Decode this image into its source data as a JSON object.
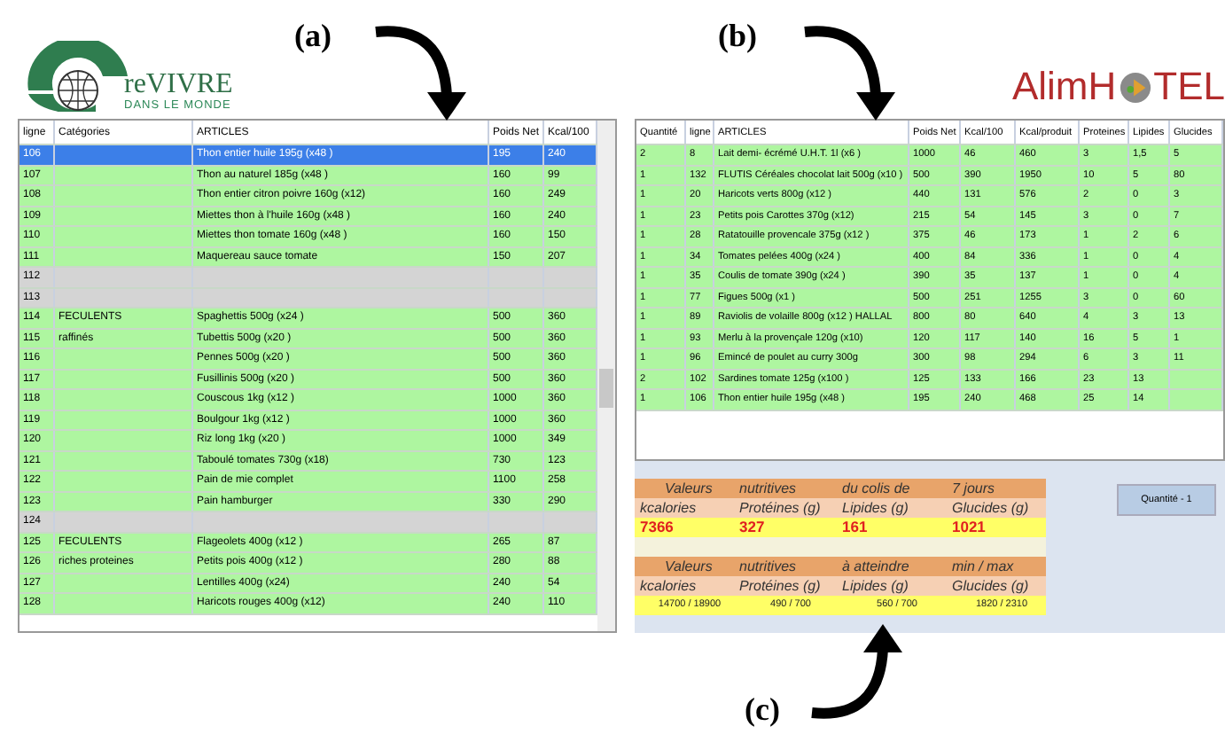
{
  "figure_labels": [
    {
      "text": "(a)"
    },
    {
      "text": "(b)"
    },
    {
      "text": "(c)"
    }
  ],
  "logo_left": {
    "name": "reVIVRE",
    "tagline": "DANS LE MONDE"
  },
  "logo_right": {
    "before": "AlimH",
    "after": "TEL"
  },
  "articles_table": {
    "columns": [
      "ligne",
      "Catégories",
      "ARTICLES",
      "Poids Net",
      "Kcal/100"
    ],
    "rows": [
      {
        "kind": "item",
        "selected": true,
        "line": "106",
        "article": "Thon entier huile 195g (x48 )",
        "weight": "195",
        "kcal": "240"
      },
      {
        "kind": "item",
        "selected": false,
        "line": "107",
        "article": "Thon au naturel 185g (x48 )",
        "weight": "160",
        "kcal": "99"
      },
      {
        "kind": "item",
        "selected": false,
        "line": "108",
        "article": "Thon entier citron poivre 160g (x12)",
        "weight": "160",
        "kcal": "249"
      },
      {
        "kind": "item",
        "selected": false,
        "line": "109",
        "article": "Miettes thon à l'huile 160g (x48 )",
        "weight": "160",
        "kcal": "240"
      },
      {
        "kind": "item",
        "selected": false,
        "line": "110",
        "article": "Miettes thon tomate 160g (x48 )",
        "weight": "160",
        "kcal": "150"
      },
      {
        "kind": "item",
        "selected": false,
        "line": "111",
        "article": "Maquereau sauce tomate",
        "weight": "150",
        "kcal": "207"
      },
      {
        "kind": "blank",
        "selected": false,
        "line": "112"
      },
      {
        "kind": "blank",
        "selected": false,
        "line": "113"
      },
      {
        "kind": "item",
        "selected": false,
        "line": "114",
        "category": "FECULENTS",
        "article": "Spaghettis 500g (x24 )",
        "weight": "500",
        "kcal": "360"
      },
      {
        "kind": "item",
        "selected": false,
        "line": "115",
        "category": "raffinés",
        "article": "Tubettis 500g (x20 )",
        "weight": "500",
        "kcal": "360"
      },
      {
        "kind": "item",
        "selected": false,
        "line": "116",
        "article": "Pennes 500g (x20 )",
        "weight": "500",
        "kcal": "360"
      },
      {
        "kind": "item",
        "selected": false,
        "line": "117",
        "article": "Fusillinis 500g (x20 )",
        "weight": "500",
        "kcal": "360"
      },
      {
        "kind": "item",
        "selected": false,
        "line": "118",
        "article": "Couscous 1kg (x12 )",
        "weight": "1000",
        "kcal": "360"
      },
      {
        "kind": "item",
        "selected": false,
        "line": "119",
        "article": "Boulgour 1kg (x12 )",
        "weight": "1000",
        "kcal": "360"
      },
      {
        "kind": "item",
        "selected": false,
        "line": "120",
        "article": "Riz long 1kg (x20 )",
        "weight": "1000",
        "kcal": "349"
      },
      {
        "kind": "item",
        "selected": false,
        "line": "121",
        "article": "Taboulé tomates 730g (x18)",
        "weight": "730",
        "kcal": "123"
      },
      {
        "kind": "item",
        "selected": false,
        "line": "122",
        "article": "Pain de mie complet",
        "weight": "1100",
        "kcal": "258"
      },
      {
        "kind": "item",
        "selected": false,
        "line": "123",
        "article": "Pain hamburger",
        "weight": "330",
        "kcal": "290"
      },
      {
        "kind": "blank",
        "selected": false,
        "line": "124"
      },
      {
        "kind": "item",
        "selected": false,
        "line": "125",
        "category": "FECULENTS",
        "article": "Flageolets 400g (x12 )",
        "weight": "265",
        "kcal": "87"
      },
      {
        "kind": "item",
        "selected": false,
        "line": "126",
        "category": "riches proteines",
        "article": "Petits pois 400g (x12 )",
        "weight": "280",
        "kcal": "88"
      },
      {
        "kind": "item",
        "selected": false,
        "line": "127",
        "article": "Lentilles 400g (x24)",
        "weight": "240",
        "kcal": "54"
      },
      {
        "kind": "item",
        "selected": false,
        "line": "128",
        "article": "Haricots rouges 400g (x12)",
        "weight": "240",
        "kcal": "110"
      }
    ]
  },
  "basket_table": {
    "columns": [
      "Quantité",
      "ligne",
      "ARTICLES",
      "Poids Net",
      "Kcal/100",
      "Kcal/produit",
      "Proteines",
      "Lipides",
      "Glucides"
    ],
    "rows": [
      [
        "2",
        "8",
        "Lait demi- écrémé U.H.T. 1l (x6 )",
        "1000",
        "46",
        "460",
        "3",
        "1,5",
        "5"
      ],
      [
        "1",
        "132",
        "FLUTIS Céréales chocolat lait 500g (x10 )",
        "500",
        "390",
        "1950",
        "10",
        "5",
        "80"
      ],
      [
        "1",
        "20",
        "Haricots verts 800g (x12 )",
        "440",
        "131",
        "576",
        "2",
        "0",
        "3"
      ],
      [
        "1",
        "23",
        "Petits pois  Carottes 370g (x12)",
        "215",
        "54",
        "145",
        "3",
        "0",
        "7"
      ],
      [
        "1",
        "28",
        "Ratatouille provencale 375g (x12 )",
        "375",
        "46",
        "173",
        "1",
        "2",
        "6"
      ],
      [
        "1",
        "34",
        "Tomates pelées 400g (x24 )",
        "400",
        "84",
        "336",
        "1",
        "0",
        "4"
      ],
      [
        "1",
        "35",
        "Coulis de tomate 390g (x24 )",
        "390",
        "35",
        "137",
        "1",
        "0",
        "4"
      ],
      [
        "1",
        "77",
        "Figues 500g (x1 )",
        "500",
        "251",
        "1255",
        "3",
        "0",
        "60"
      ],
      [
        "1",
        "89",
        "Raviolis de volaille 800g (x12 ) HALLAL",
        "800",
        "80",
        "640",
        "4",
        "3",
        "13"
      ],
      [
        "1",
        "93",
        "Merlu à la  provençale 120g (x10)",
        "120",
        "117",
        "140",
        "16",
        "5",
        "1"
      ],
      [
        "1",
        "96",
        "Emincé de poulet au curry 300g",
        "300",
        "98",
        "294",
        "6",
        "3",
        "11"
      ],
      [
        "2",
        "102",
        "Sardines tomate 125g (x100 )",
        "125",
        "133",
        "166",
        "23",
        "13",
        null
      ],
      [
        "1",
        "106",
        "Thon entier huile 195g (x48 )",
        "195",
        "240",
        "468",
        "25",
        "14",
        null
      ]
    ]
  },
  "nutrition": [
    {
      "heading": [
        "Valeurs",
        "nutritives",
        "du colis de",
        "7 jours"
      ],
      "labels": [
        "kcalories",
        "Protéines (g)",
        "Lipides (g)",
        "Glucides (g)"
      ],
      "kind": "totals",
      "values": [
        "7366",
        "327",
        "161",
        "1021"
      ]
    },
    {
      "heading": [
        "Valeurs",
        "nutritives",
        "à  atteindre",
        "min / max"
      ],
      "labels": [
        "kcalories",
        "Protéines (g)",
        "Lipides (g)",
        "Glucides (g)"
      ],
      "kind": "targets",
      "values": [
        "14700 / 18900",
        "490 / 700",
        "560 / 700",
        "1820 / 2310"
      ]
    }
  ],
  "quantity_button": {
    "label": "Quantité  - 1"
  }
}
